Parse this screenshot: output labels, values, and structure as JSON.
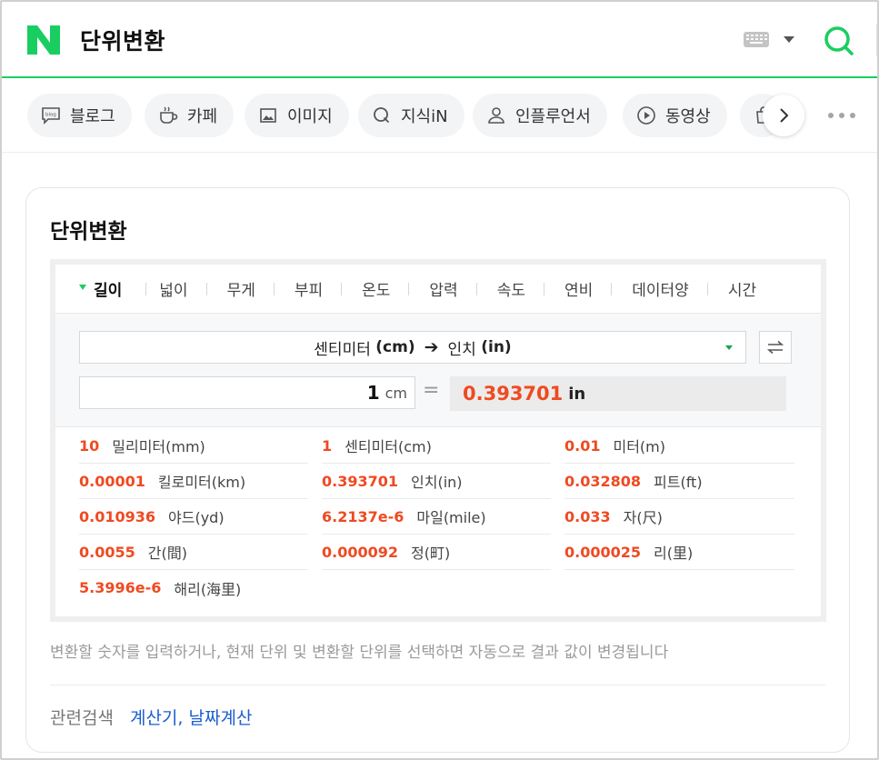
{
  "header": {
    "query": "단위변환",
    "logo": "naver-n-logo",
    "brand_color": "#19ce60",
    "icons": [
      "keyboard-icon",
      "dropdown-caret-icon",
      "search-icon"
    ]
  },
  "tabs": [
    {
      "label": "블로그",
      "icon": "blog-icon"
    },
    {
      "label": "카페",
      "icon": "cafe-icon"
    },
    {
      "label": "이미지",
      "icon": "image-icon"
    },
    {
      "label": "지식iN",
      "icon": "kin-icon"
    },
    {
      "label": "인플루언서",
      "icon": "person-icon"
    },
    {
      "label": "동영상",
      "icon": "play-icon"
    }
  ],
  "card": {
    "title": "단위변환",
    "categories": [
      "길이",
      "넓이",
      "무게",
      "부피",
      "온도",
      "압력",
      "속도",
      "연비",
      "데이터양",
      "시간"
    ],
    "selected_category": "길이",
    "selector": {
      "from_name": "센티미터",
      "from_unit": "(cm)",
      "to_name": "인치",
      "to_unit": "(in)"
    },
    "input": {
      "value": "1",
      "unit": "cm"
    },
    "equals": "=",
    "output": {
      "value": "0.393701",
      "unit": "in"
    },
    "results": [
      {
        "value": "10",
        "label": "밀리미터(mm)"
      },
      {
        "value": "1",
        "label": "센티미터(cm)"
      },
      {
        "value": "0.01",
        "label": "미터(m)"
      },
      {
        "value": "0.00001",
        "label": "킬로미터(km)"
      },
      {
        "value": "0.393701",
        "label": "인치(in)"
      },
      {
        "value": "0.032808",
        "label": "피트(ft)"
      },
      {
        "value": "0.010936",
        "label": "야드(yd)"
      },
      {
        "value": "6.2137e-6",
        "label": "마일(mile)"
      },
      {
        "value": "0.033",
        "label": "자(尺)"
      },
      {
        "value": "0.0055",
        "label": "간(間)"
      },
      {
        "value": "0.000092",
        "label": "정(町)"
      },
      {
        "value": "0.000025",
        "label": "리(里)"
      },
      {
        "value": "5.3996e-6",
        "label": "해리(海里)"
      }
    ],
    "help_text": "변환할 숫자를 입력하거나, 현재 단위 및 변환할 단위를 선택하면 자동으로 결과 값이 변경됩니다",
    "related": {
      "label": "관련검색",
      "links": [
        "계산기,",
        "날짜계산"
      ]
    },
    "value_color": "#ef4a21",
    "link_color": "#1c5ecf"
  }
}
